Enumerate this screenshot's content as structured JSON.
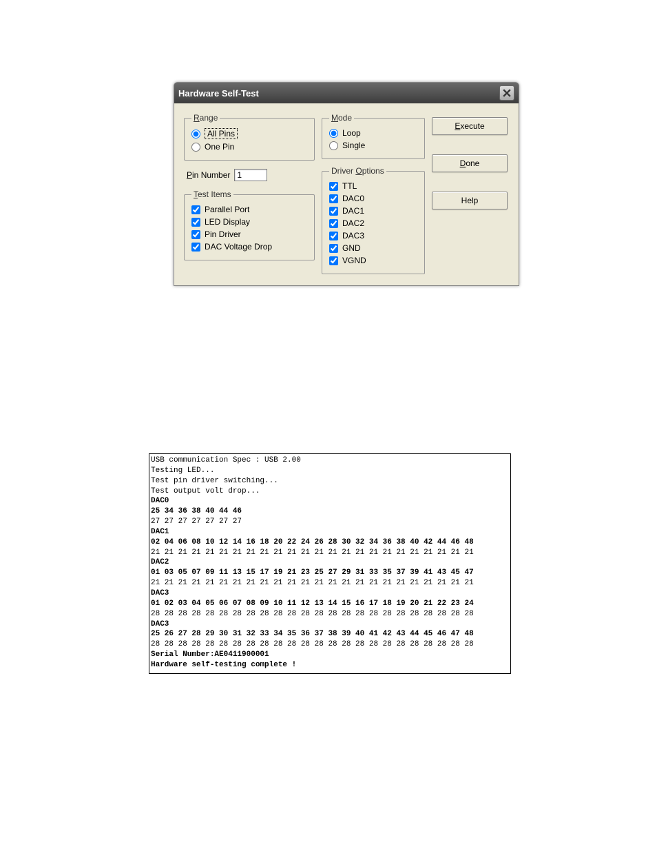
{
  "dialog": {
    "title": "Hardware Self-Test",
    "range": {
      "legend_prefix": "R",
      "legend": "ange",
      "options": {
        "all_pins": "All Pins",
        "one_pin": "One Pin"
      },
      "selected": "all_pins"
    },
    "mode": {
      "legend_prefix": "M",
      "legend": "ode",
      "options": {
        "loop": "Loop",
        "single": "Single"
      },
      "selected": "loop"
    },
    "pin_number": {
      "label_prefix": "P",
      "label": "in Number",
      "value": "1"
    },
    "test_items": {
      "legend_prefix": "T",
      "legend": "est Items",
      "items": [
        {
          "label": "Parallel Port",
          "checked": true
        },
        {
          "label": "LED Display",
          "checked": true
        },
        {
          "label": "Pin Driver",
          "checked": true
        },
        {
          "label": "DAC Voltage Drop",
          "checked": true
        }
      ]
    },
    "driver_options": {
      "legend_pre": "Driver ",
      "legend_u": "O",
      "legend_post": "ptions",
      "items": [
        {
          "label": "TTL",
          "checked": true
        },
        {
          "label": "DAC0",
          "checked": true
        },
        {
          "label": "DAC1",
          "checked": true
        },
        {
          "label": "DAC2",
          "checked": true
        },
        {
          "label": "DAC3",
          "checked": true
        },
        {
          "label": "GND",
          "checked": true
        },
        {
          "label": "VGND",
          "checked": true
        }
      ]
    },
    "buttons": {
      "execute_u": "E",
      "execute": "xecute",
      "done_u": "D",
      "done": "one",
      "help": "Help"
    }
  },
  "console": {
    "lines": [
      {
        "text": "USB communication Spec : USB 2.00",
        "bold": false
      },
      {
        "text": "Testing LED...",
        "bold": false
      },
      {
        "text": "Test pin driver switching...",
        "bold": false
      },
      {
        "text": "Test output volt drop...",
        "bold": false
      },
      {
        "text": "DAC0",
        "bold": true
      },
      {
        "text": "25 34 36 38 40 44 46",
        "bold": true
      },
      {
        "text": "27 27 27 27 27 27 27",
        "bold": false
      },
      {
        "text": "DAC1",
        "bold": true
      },
      {
        "text": "02 04 06 08 10 12 14 16 18 20 22 24 26 28 30 32 34 36 38 40 42 44 46 48",
        "bold": true
      },
      {
        "text": "21 21 21 21 21 21 21 21 21 21 21 21 21 21 21 21 21 21 21 21 21 21 21 21",
        "bold": false
      },
      {
        "text": "DAC2",
        "bold": true
      },
      {
        "text": "01 03 05 07 09 11 13 15 17 19 21 23 25 27 29 31 33 35 37 39 41 43 45 47",
        "bold": true
      },
      {
        "text": "21 21 21 21 21 21 21 21 21 21 21 21 21 21 21 21 21 21 21 21 21 21 21 21",
        "bold": false
      },
      {
        "text": "DAC3",
        "bold": true
      },
      {
        "text": "01 02 03 04 05 06 07 08 09 10 11 12 13 14 15 16 17 18 19 20 21 22 23 24",
        "bold": true
      },
      {
        "text": "28 28 28 28 28 28 28 28 28 28 28 28 28 28 28 28 28 28 28 28 28 28 28 28",
        "bold": false
      },
      {
        "text": "DAC3",
        "bold": true
      },
      {
        "text": "25 26 27 28 29 30 31 32 33 34 35 36 37 38 39 40 41 42 43 44 45 46 47 48",
        "bold": true
      },
      {
        "text": "28 28 28 28 28 28 28 28 28 28 28 28 28 28 28 28 28 28 28 28 28 28 28 28",
        "bold": false
      },
      {
        "text": "Serial Number:AE0411900001",
        "bold": true
      },
      {
        "text": "Hardware self-testing complete !",
        "bold": true
      }
    ]
  }
}
